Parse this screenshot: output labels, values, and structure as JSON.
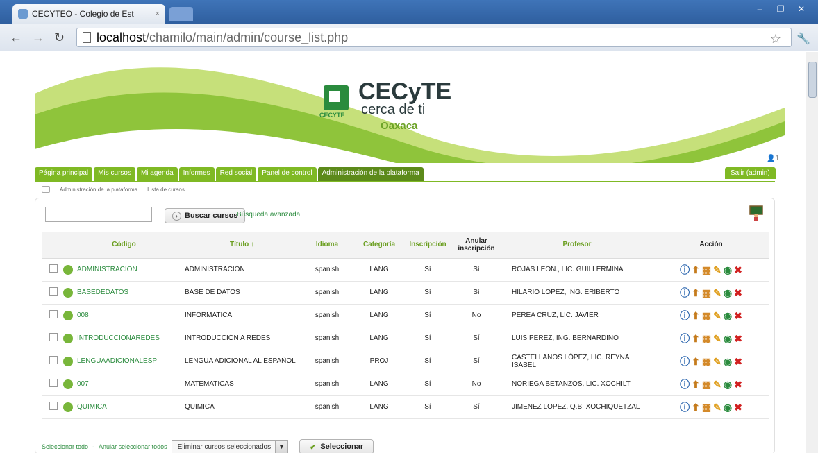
{
  "browser": {
    "tab_title": "CECYTEO - Colegio de Est",
    "tab_close": "×",
    "url_host": "localhost",
    "url_path": "/chamilo/main/admin/course_list.php",
    "window_buttons": [
      "–",
      "❐",
      "✕"
    ]
  },
  "banner": {
    "logo_title": "CECyTE",
    "logo_sub": "cerca de ti",
    "logo_city": "Oaxaca",
    "logo_small": "CECYTE"
  },
  "menu": {
    "items": [
      "Página principal",
      "Mis cursos",
      "Mi agenda",
      "Informes",
      "Red social",
      "Panel de control",
      "Administración de la plataforma"
    ],
    "logout": "Salir (admin)",
    "user_count": "1"
  },
  "breadcrumb": {
    "items": [
      "Administración de la plataforma",
      "Lista de cursos"
    ]
  },
  "search": {
    "button": "Buscar cursos",
    "advanced": "Búsqueda avanzada"
  },
  "table": {
    "headers": [
      "Código",
      "Título ↑",
      "Idioma",
      "Categoría",
      "Inscripción",
      "Anular inscripción",
      "Profesor",
      "Acción"
    ],
    "rows": [
      {
        "code": "ADMINISTRACION",
        "title": "ADMINISTRACION",
        "lang": "spanish",
        "category": "LANG",
        "subscribe": "Sí",
        "unsubscribe": "Sí",
        "teacher": "ROJAS LEON., LIC. GUILLERMINA"
      },
      {
        "code": "BASEDEDATOS",
        "title": "BASE DE DATOS",
        "lang": "spanish",
        "category": "LANG",
        "subscribe": "Sí",
        "unsubscribe": "Sí",
        "teacher": "HILARIO LOPEZ, ING. ERIBERTO"
      },
      {
        "code": "008",
        "title": "INFORMATICA",
        "lang": "spanish",
        "category": "LANG",
        "subscribe": "Sí",
        "unsubscribe": "No",
        "teacher": "PEREA CRUZ, LIC. JAVIER"
      },
      {
        "code": "INTRODUCCIONAREDES",
        "title": "INTRODUCCIÓN A REDES",
        "lang": "spanish",
        "category": "LANG",
        "subscribe": "Sí",
        "unsubscribe": "Sí",
        "teacher": "LUIS PEREZ, ING. BERNARDINO"
      },
      {
        "code": "LENGUAADICIONALESP",
        "title": "LENGUA ADICIONAL AL ESPAÑOL",
        "lang": "spanish",
        "category": "PROJ",
        "subscribe": "Sí",
        "unsubscribe": "Sí",
        "teacher": "CASTELLANOS LÓPEZ, LIC. REYNA ISABEL"
      },
      {
        "code": "007",
        "title": "MATEMATICAS",
        "lang": "spanish",
        "category": "LANG",
        "subscribe": "Sí",
        "unsubscribe": "No",
        "teacher": "NORIEGA BETANZOS, LIC. XOCHILT"
      },
      {
        "code": "QUIMICA",
        "title": "QUIMICA",
        "lang": "spanish",
        "category": "LANG",
        "subscribe": "Sí",
        "unsubscribe": "Sí",
        "teacher": "JIMENEZ LOPEZ, Q.B. XOCHIQUETZAL"
      }
    ]
  },
  "footer": {
    "select_all": "Seleccionar todo",
    "separator": " - ",
    "unselect_all": "Anular seleccionar todos",
    "bulk_action": "Eliminar cursos seleccionados",
    "submit": "Seleccionar"
  },
  "colors": {
    "accent_green": "#7fb924",
    "link_green": "#2a8b3d"
  }
}
